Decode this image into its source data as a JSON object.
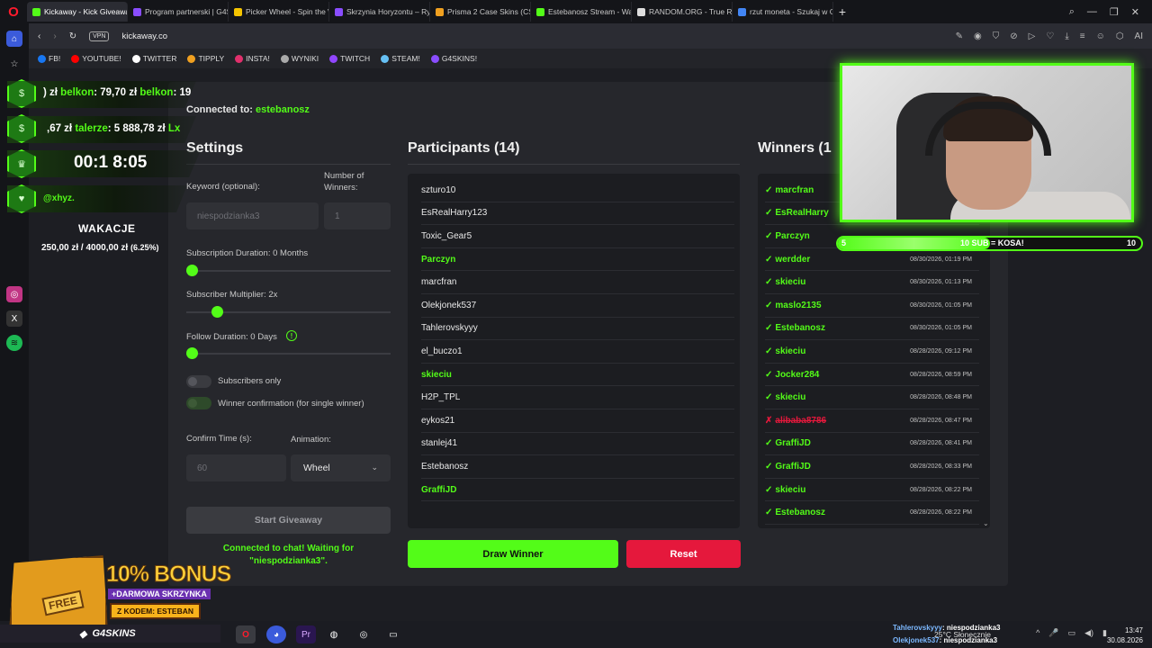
{
  "browser": {
    "tabs": [
      {
        "label": "Kickaway - Kick Giveaway",
        "color": "#53fc18",
        "active": true
      },
      {
        "label": "Program partnerski | G4S",
        "color": "#8a4dff"
      },
      {
        "label": "Picker Wheel - Spin the W",
        "color": "#f5c400"
      },
      {
        "label": "Skrzynia Horyzontu – Ryn",
        "color": "#8a4dff"
      },
      {
        "label": "Prisma 2 Case Skins (CS2",
        "color": "#f0a020"
      },
      {
        "label": "Estebanosz Stream - Wat",
        "color": "#53fc18"
      },
      {
        "label": "RANDOM.ORG - True Ran",
        "color": "#dddddd"
      },
      {
        "label": "rzut moneta - Szukaj w Go",
        "color": "#4285f4"
      }
    ],
    "url": "kickaway.co",
    "vpn": "VPN",
    "ai_label": "AI",
    "bookmarks": [
      {
        "label": "FB!",
        "color": "#1877f2"
      },
      {
        "label": "YOUTUBE!",
        "color": "#ff0000"
      },
      {
        "label": "TWITTER",
        "color": "#ffffff"
      },
      {
        "label": "TIPPLY",
        "color": "#f0a020"
      },
      {
        "label": "INSTA!",
        "color": "#e1306c"
      },
      {
        "label": "WYNIKI",
        "color": "#aaaaaa"
      },
      {
        "label": "TWITCH",
        "color": "#9146ff"
      },
      {
        "label": "STEAM!",
        "color": "#66c0f4"
      },
      {
        "label": "G4SKINS!",
        "color": "#8a4dff"
      }
    ]
  },
  "app": {
    "connected_prefix": "Connected to: ",
    "connected_channel": "estebanosz",
    "settings": {
      "title": "Settings",
      "keyword_label": "Keyword (optional):",
      "keyword_value": "niespodzianka3",
      "winners_label": "Number of Winners:",
      "winners_value": "1",
      "subscription_label": "Subscription Duration: 0 Months",
      "subscription_level": 0,
      "multiplier_label": "Subscriber Multiplier: 2x",
      "multiplier_level": 0.13,
      "follow_label": "Follow Duration:  0  Days",
      "follow_level": 0,
      "subs_only_label": "Subscribers only",
      "winner_confirm_label": "Winner confirmation (for single winner)",
      "confirm_time_label": "Confirm Time (s):",
      "confirm_time_value": "60",
      "animation_label": "Animation:",
      "animation_value": "Wheel",
      "start_button": "Start Giveaway",
      "status_line1": "Connected to chat! Waiting for",
      "status_line2": "\"niespodzianka3\"."
    },
    "participants": {
      "title": "Participants (14)",
      "items": [
        {
          "name": "szturo10",
          "sub": false
        },
        {
          "name": "EsRealHarry123",
          "sub": false
        },
        {
          "name": "Toxic_Gear5",
          "sub": false
        },
        {
          "name": "Parczyn",
          "sub": true
        },
        {
          "name": "marcfran",
          "sub": false
        },
        {
          "name": "Olekjonek537",
          "sub": false
        },
        {
          "name": "Tahlerovskyyy",
          "sub": false
        },
        {
          "name": "el_buczo1",
          "sub": false
        },
        {
          "name": "skieciu",
          "sub": true
        },
        {
          "name": "H2P_TPL",
          "sub": false
        },
        {
          "name": "eykos21",
          "sub": false
        },
        {
          "name": "stanlej41",
          "sub": false
        },
        {
          "name": "Estebanosz",
          "sub": false
        },
        {
          "name": "GraffiJD",
          "sub": true
        }
      ],
      "draw_button": "Draw Winner",
      "reset_button": "Reset"
    },
    "winners": {
      "title": "Winners (1",
      "items": [
        {
          "mark": "✓",
          "name": "marcfran",
          "time": "",
          "rejected": false
        },
        {
          "mark": "✓",
          "name": "EsRealHarry",
          "time": "",
          "rejected": false
        },
        {
          "mark": "✓",
          "name": "Parczyn",
          "time": "",
          "rejected": false
        },
        {
          "mark": "✓",
          "name": "werdder",
          "time": "08/30/2026, 01:19 PM",
          "rejected": false
        },
        {
          "mark": "✓",
          "name": "skieciu",
          "time": "08/30/2026, 01:13 PM",
          "rejected": false
        },
        {
          "mark": "✓",
          "name": "maslo2135",
          "time": "08/30/2026, 01:05 PM",
          "rejected": false
        },
        {
          "mark": "✓",
          "name": "Estebanosz",
          "time": "08/30/2026, 01:05 PM",
          "rejected": false
        },
        {
          "mark": "✓",
          "name": "skieciu",
          "time": "08/28/2026, 09:12 PM",
          "rejected": false
        },
        {
          "mark": "✓",
          "name": "Jocker284",
          "time": "08/28/2026, 08:59 PM",
          "rejected": false
        },
        {
          "mark": "✓",
          "name": "skieciu",
          "time": "08/28/2026, 08:48 PM",
          "rejected": false
        },
        {
          "mark": "✗",
          "name": "alibaba8786",
          "time": "08/28/2026, 08:47 PM",
          "rejected": true
        },
        {
          "mark": "✓",
          "name": "GraffiJD",
          "time": "08/28/2026, 08:41 PM",
          "rejected": false
        },
        {
          "mark": "✓",
          "name": "GraffiJD",
          "time": "08/28/2026, 08:33 PM",
          "rejected": false
        },
        {
          "mark": "✓",
          "name": "skieciu",
          "time": "08/28/2026, 08:22 PM",
          "rejected": false
        },
        {
          "mark": "✓",
          "name": "Estebanosz",
          "time": "08/28/2026, 08:22 PM",
          "rejected": false
        }
      ]
    }
  },
  "overlay": {
    "row1_a": ") zł ",
    "row1_b": "belkon",
    "row1_c": ": 79,70 zł ",
    "row1_d": "belkon",
    "row1_e": ": 19",
    "row2_a": ",67 zł ",
    "row2_b": "talerze",
    "row2_c": ": 5 888,78 zł ",
    "row2_d": "Lx",
    "timer": "00:1 8:05",
    "handle": "@xhyz.",
    "goal_title": "WAKACJE",
    "goal_amount": "250,00 zł / 4000,00 zł",
    "goal_pct": "(6.25%)",
    "sub_goal_left": "5",
    "sub_goal_text": "10 SUB = KOSA!",
    "sub_goal_right": "10",
    "sub_goal_progress": 0.5
  },
  "promo": {
    "bonus": "10% BONUS",
    "sub": "+DARMOWA SKRZYNKA",
    "code": "Z KODEM: ESTEBAN",
    "free": "FREE",
    "brand": "G4SKINS"
  },
  "taskbar": {
    "chat1_user": "Tahlerovskyyy",
    "chat1_msg": ": niespodzianka3",
    "chat2_user": "Olekjonek537",
    "chat2_msg": ": niespodzianka3",
    "weather": "25°C  Słonecznie",
    "time": "13:47",
    "date": "30.08.2026"
  },
  "colors": {
    "kick_green": "#53fc18",
    "reset_red": "#e5183c"
  }
}
